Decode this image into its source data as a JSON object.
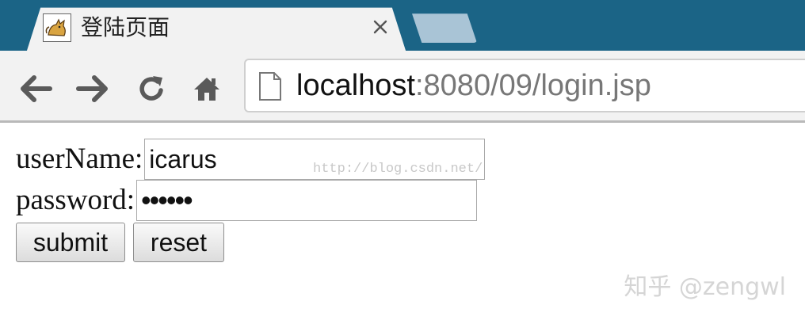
{
  "browser": {
    "tab": {
      "title": "登陆页面",
      "favicon": "tomcat-icon",
      "close_icon": "close-icon"
    },
    "new_tab": "new-tab-button",
    "nav": {
      "back_icon": "back-arrow-icon",
      "forward_icon": "forward-arrow-icon",
      "reload_icon": "reload-icon",
      "home_icon": "home-icon"
    },
    "address": {
      "host": "localhost",
      "rest": ":8080/09/login.jsp",
      "icon": "page-icon"
    }
  },
  "form": {
    "username_label": "userName:",
    "username_value": "icarus",
    "password_label": "password:",
    "password_value": "••••••",
    "submit_label": "submit",
    "reset_label": "reset"
  },
  "watermarks": {
    "blog_url": "http://blog.csdn.net/",
    "zhihu": "知乎 @zengwl"
  },
  "colors": {
    "tabstrip": "#1b6486",
    "tab_bg": "#f2f2f2",
    "toolbar_bg": "#f2f2f2",
    "nav_icon": "#5a5a5a",
    "url_host": "#111111",
    "url_rest": "#777777"
  }
}
